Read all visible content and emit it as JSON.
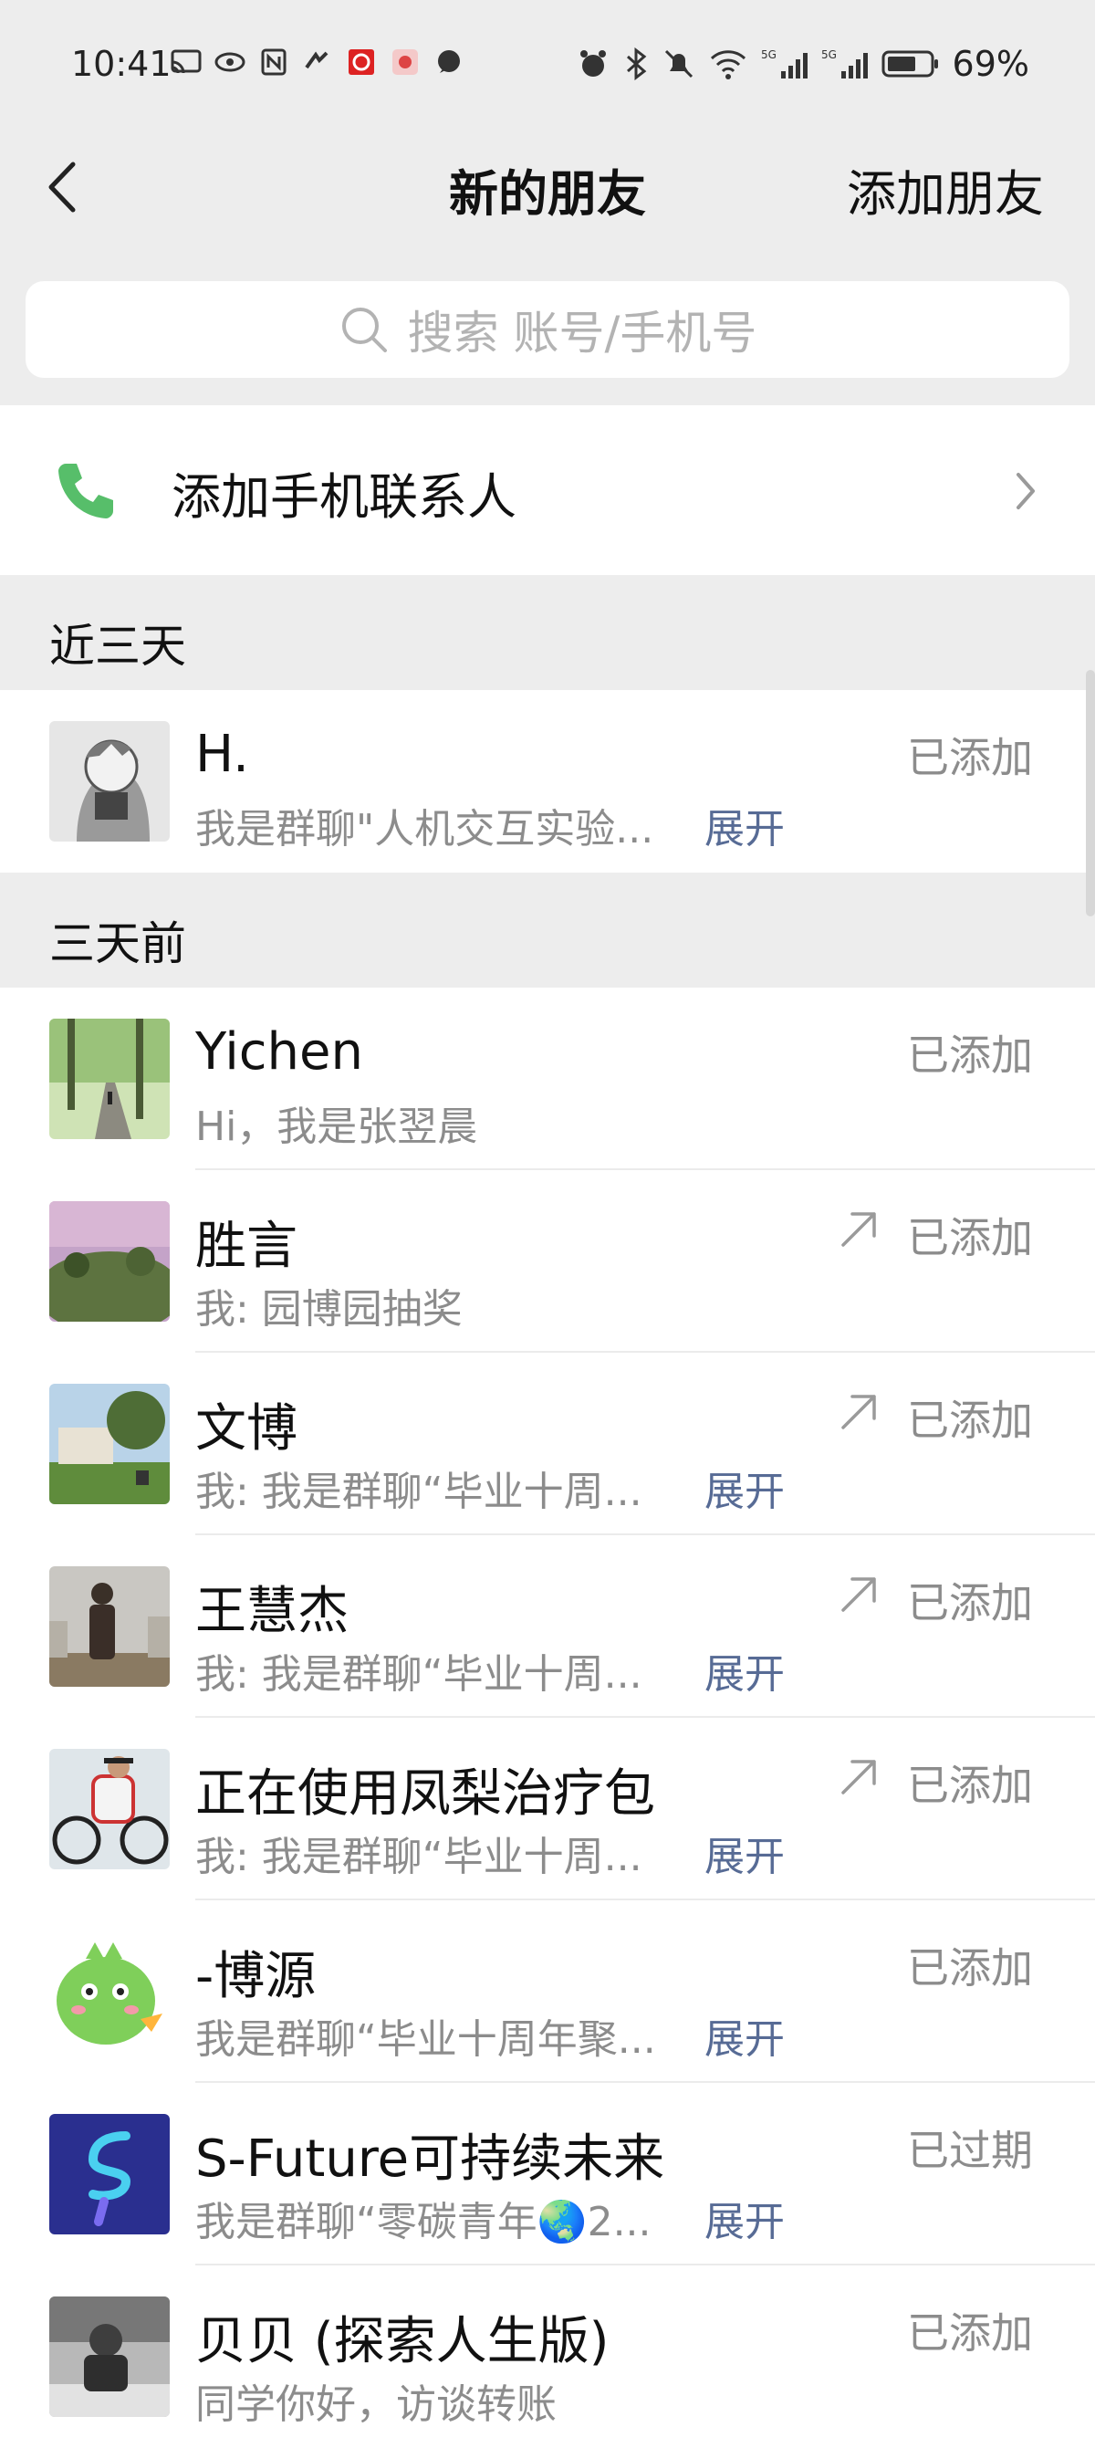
{
  "status_bar": {
    "time": "10:41",
    "battery": "69%"
  },
  "nav": {
    "title": "新的朋友",
    "action": "添加朋友"
  },
  "search": {
    "placeholder": "搜索 账号/手机号"
  },
  "add_contacts": {
    "label": "添加手机联系人"
  },
  "sections": [
    {
      "title": "近三天"
    },
    {
      "title": "三天前"
    }
  ],
  "recent": [
    {
      "name": "H.",
      "message": "我是群聊\"人机交互实验...",
      "expand": "展开",
      "status": "已添加"
    }
  ],
  "earlier": [
    {
      "name": "Yichen",
      "message": "Hi，我是张翌晨",
      "status": "已添加"
    },
    {
      "name": "胜言",
      "message": "我: 园博园抽奖",
      "status": "已添加"
    },
    {
      "name": "文博",
      "message": "我: 我是群聊“毕业十周...",
      "expand": "展开",
      "status": "已添加"
    },
    {
      "name": "王慧杰",
      "message": "我: 我是群聊“毕业十周...",
      "expand": "展开",
      "status": "已添加"
    },
    {
      "name": "正在使用凤梨治疗包",
      "message": "我: 我是群聊“毕业十周...",
      "expand": "展开",
      "status": "已添加"
    },
    {
      "name": "-博源",
      "message": "我是群聊“毕业十周年聚...",
      "expand": "展开",
      "status": "已添加"
    },
    {
      "name": "S-Future可持续未来",
      "message": "我是群聊“零碳青年🌏2...",
      "expand": "展开",
      "status": "已过期"
    },
    {
      "name": "贝贝 (探索人生版)",
      "message": "同学你好，访谈转账",
      "status": "已添加"
    }
  ],
  "colors": {
    "link": "#576b95",
    "phone_green": "#57be6a",
    "status_gray": "#8c8c8c"
  }
}
